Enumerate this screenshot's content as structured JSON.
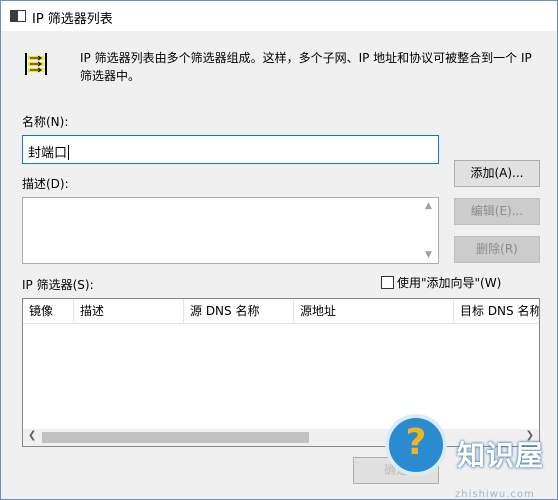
{
  "window": {
    "title": "IP 筛选器列表"
  },
  "intro": {
    "text": "IP 筛选器列表由多个筛选器组成。这样，多个子网、IP 地址和协议可被整合到一个 IP 筛选器中。"
  },
  "name": {
    "label": "名称(N):",
    "value": "封端口"
  },
  "description": {
    "label": "描述(D):",
    "value": ""
  },
  "buttons": {
    "add": "添加(A)...",
    "edit": "编辑(E)...",
    "delete": "删除(R)",
    "ok": "确定"
  },
  "filters": {
    "label": "IP 筛选器(S):",
    "wizard_label": "使用\"添加向导\"(W)",
    "wizard_checked": false,
    "columns": [
      "镜像",
      "描述",
      "源 DNS 名称",
      "源地址",
      "目标 DNS 名称"
    ],
    "rows": []
  },
  "watermark": {
    "brand": "知识屋",
    "url": "zhishiwu.com"
  }
}
